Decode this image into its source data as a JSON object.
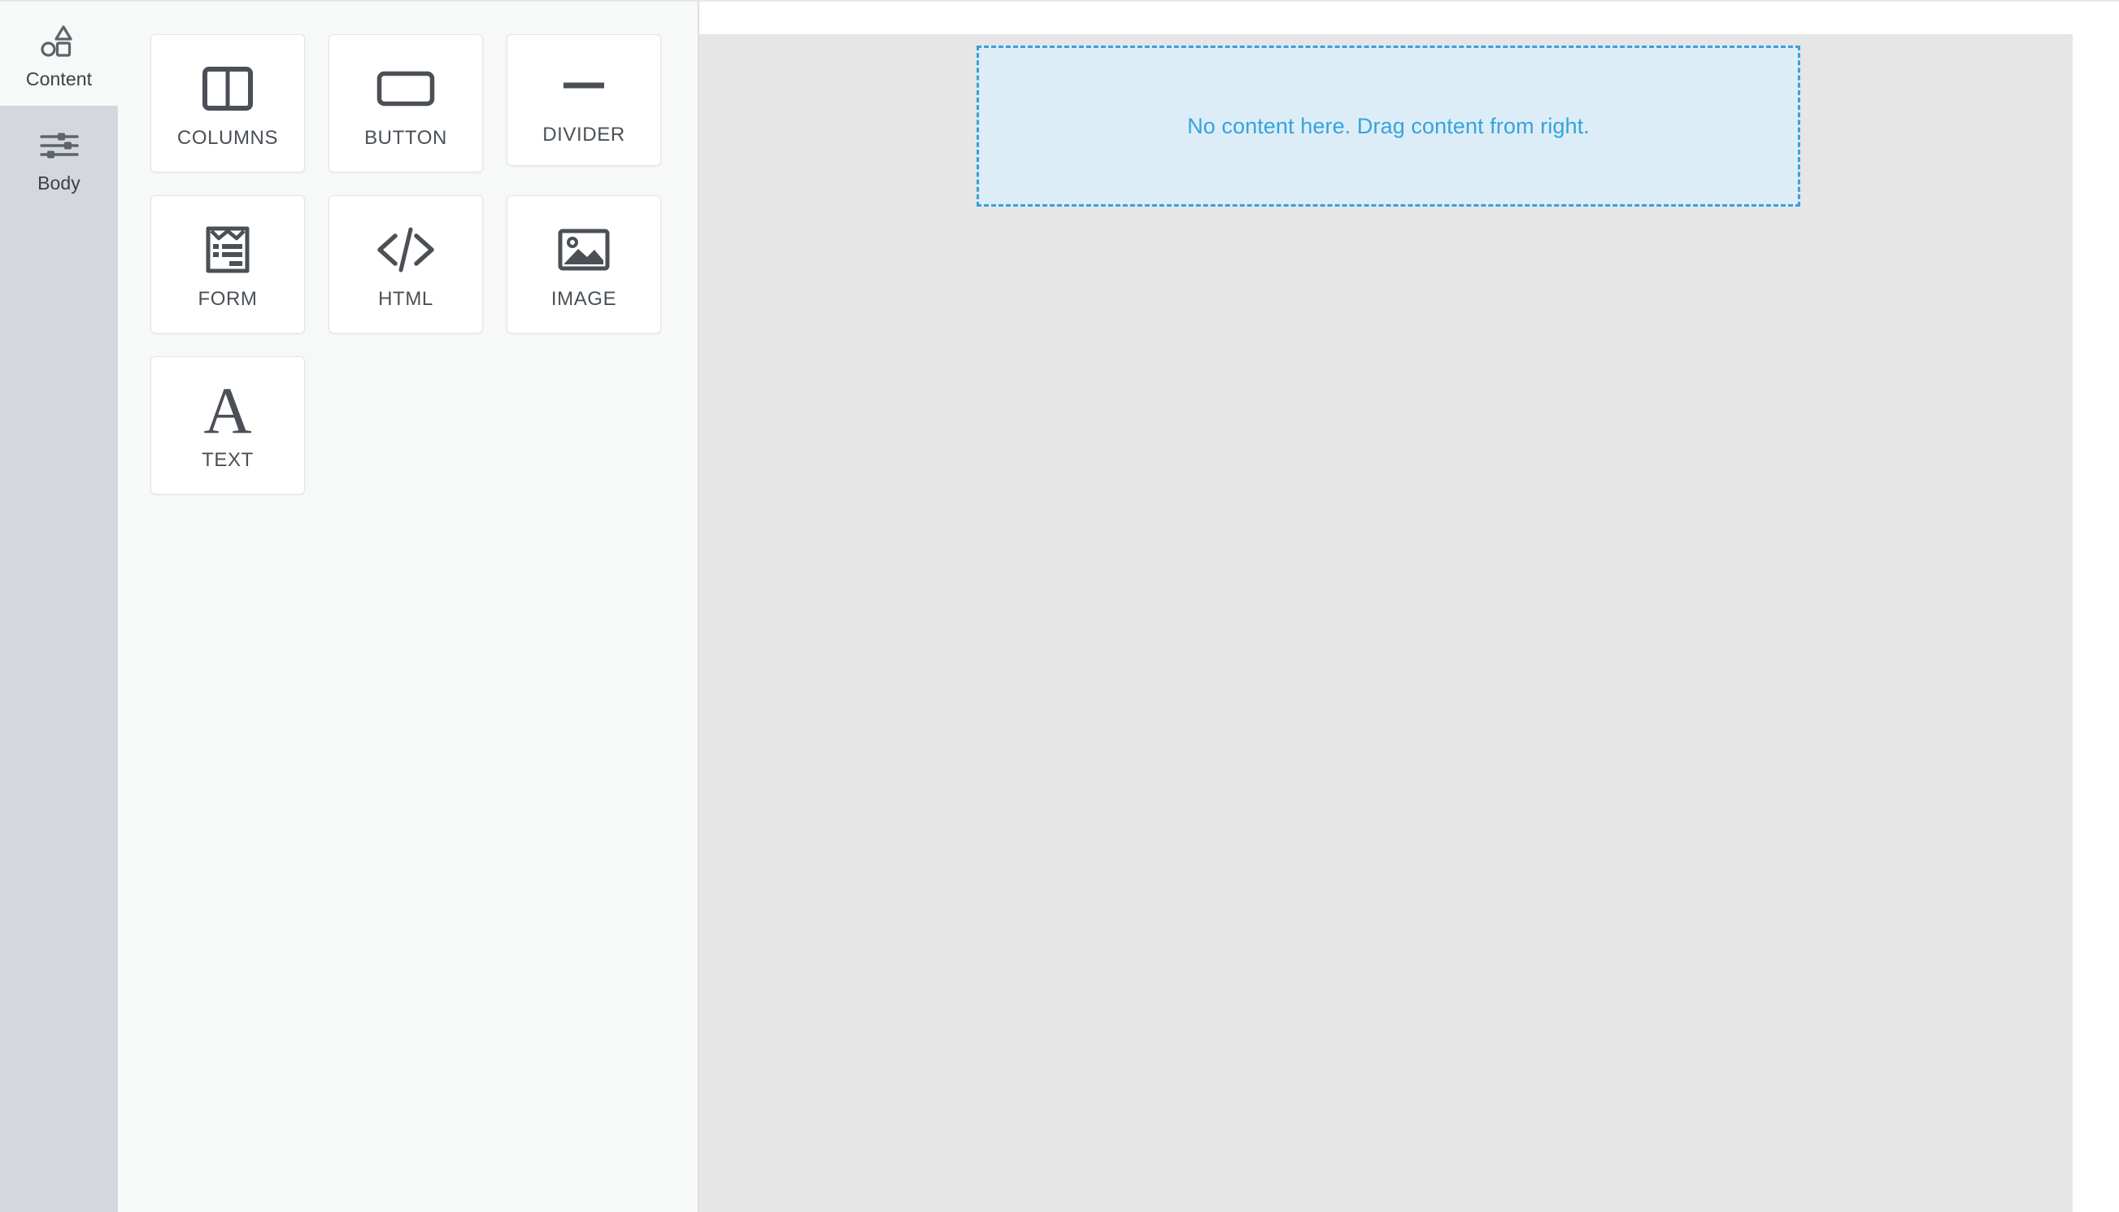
{
  "sidebar": {
    "items": [
      {
        "label": "Content",
        "icon": "shapes-icon",
        "active": false
      },
      {
        "label": "Body",
        "icon": "sliders-icon",
        "active": true
      }
    ]
  },
  "blocks_panel": {
    "tiles": [
      {
        "label": "COLUMNS",
        "icon": "columns-icon"
      },
      {
        "label": "BUTTON",
        "icon": "button-icon"
      },
      {
        "label": "DIVIDER",
        "icon": "divider-icon"
      },
      {
        "label": "FORM",
        "icon": "form-icon"
      },
      {
        "label": "HTML",
        "icon": "code-icon"
      },
      {
        "label": "IMAGE",
        "icon": "image-icon"
      },
      {
        "label": "TEXT",
        "icon": "text-a-icon",
        "glyph": "A"
      }
    ]
  },
  "canvas": {
    "dropzone": {
      "message": "No content here. Drag content from right."
    }
  },
  "colors": {
    "accent_blue": "#36a3dd",
    "dropzone_fill": "#dcedf7",
    "canvas_bg": "#e6e6e6",
    "panel_bg": "#f7f8f8",
    "active_rail": "#d4d8dc",
    "icon_gray": "#4a5055"
  }
}
